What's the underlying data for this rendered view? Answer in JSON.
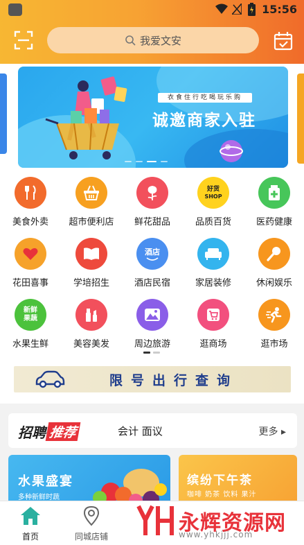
{
  "status_bar": {
    "time": "15:56"
  },
  "search": {
    "placeholder": "我爱文安"
  },
  "banner": {
    "subtitle": "衣食住行吃喝玩乐购",
    "title": "诚邀商家入驻"
  },
  "categories": [
    {
      "label": "美食外卖",
      "icon": "fork-knife-icon",
      "color": "#f26b2c"
    },
    {
      "label": "超市便利店",
      "icon": "basket-icon",
      "color": "#f7a020"
    },
    {
      "label": "鲜花甜品",
      "icon": "rose-icon",
      "color": "#f2505c"
    },
    {
      "label": "品质百货",
      "icon": "shop-badge-icon",
      "badge": "好货",
      "badge2": "SHOP",
      "color": "#ffd21e"
    },
    {
      "label": "医药健康",
      "icon": "medicine-icon",
      "color": "#47c65a"
    },
    {
      "label": "花田喜事",
      "icon": "heart-icon",
      "color": "#f6a22a"
    },
    {
      "label": "学培招生",
      "icon": "book-icon",
      "color": "#ee4a3c"
    },
    {
      "label": "酒店民宿",
      "icon": "hotel-badge-icon",
      "badge": "酒店",
      "color": "#4a8ff0"
    },
    {
      "label": "家居装修",
      "icon": "sofa-icon",
      "color": "#34b4ee"
    },
    {
      "label": "休闲娱乐",
      "icon": "microphone-icon",
      "color": "#f7961e"
    },
    {
      "label": "水果生鲜",
      "icon": "fresh-fruit-icon",
      "badge": "新鲜",
      "badge2": "果蔬",
      "color": "#4cc23c"
    },
    {
      "label": "美容美发",
      "icon": "cosmetics-icon",
      "color": "#f2505c"
    },
    {
      "label": "周边旅游",
      "icon": "mountain-icon",
      "color": "#8a5ee8"
    },
    {
      "label": "逛商场",
      "icon": "cart-icon",
      "color": "#f2507e"
    },
    {
      "label": "逛市场",
      "icon": "runner-icon",
      "color": "#f7961e"
    }
  ],
  "plate_query": {
    "label": "限号出行查询"
  },
  "recruit": {
    "logo_a": "招聘",
    "logo_b": "推荐",
    "keywords": "会计 面议",
    "more": "更多 ▸"
  },
  "promos": [
    {
      "title": "水果盛宴",
      "subtitle": "多种新鲜时蔬"
    },
    {
      "title": "缤纷下午茶",
      "subtitle": "咖啡 奶茶 饮料 果汁"
    }
  ],
  "nav": {
    "items": [
      {
        "label": "首页",
        "icon": "home-icon",
        "active": true
      },
      {
        "label": "同城店铺",
        "icon": "map-pin-icon",
        "active": false
      }
    ]
  },
  "watermark": {
    "name": "永辉资源网",
    "url": "www.yhkjjj.com"
  }
}
